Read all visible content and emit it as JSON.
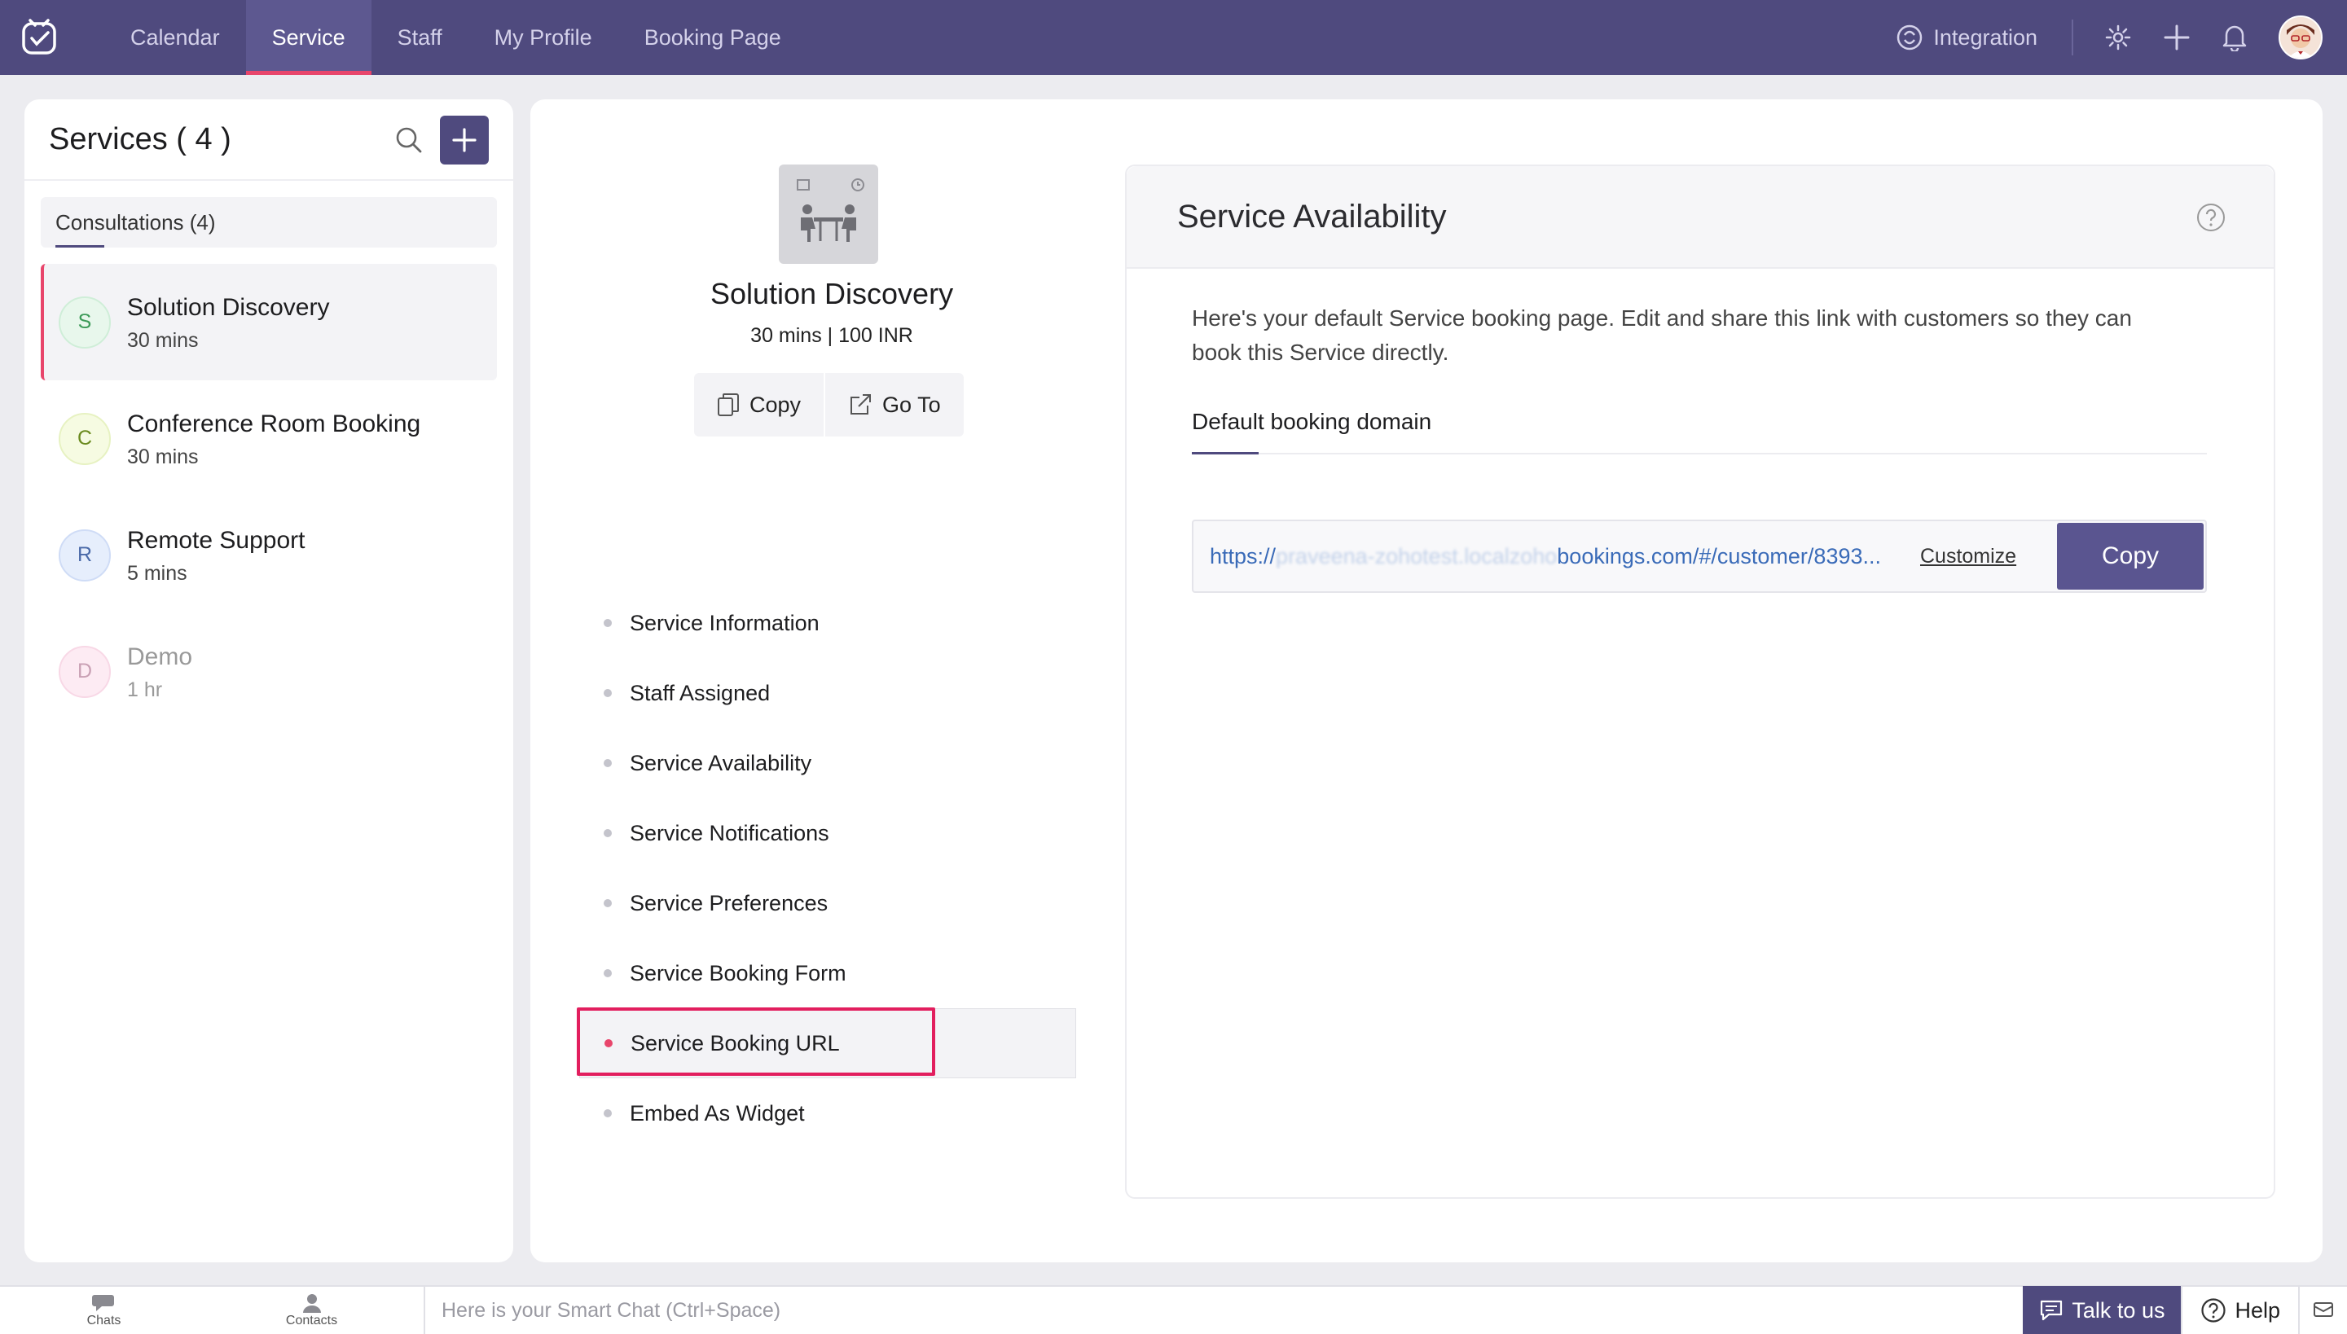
{
  "nav": {
    "items": [
      {
        "label": "Calendar",
        "active": false
      },
      {
        "label": "Service",
        "active": true
      },
      {
        "label": "Staff",
        "active": false
      },
      {
        "label": "My Profile",
        "active": false
      },
      {
        "label": "Booking Page",
        "active": false
      }
    ],
    "integration": "Integration"
  },
  "sidebar": {
    "title": "Services ( 4 )",
    "category": "Consultations (4)",
    "services": [
      {
        "initial": "S",
        "name": "Solution Discovery",
        "duration": "30 mins",
        "selected": true,
        "avatar_bg": "#e8f7ec",
        "avatar_fg": "#3c9a58"
      },
      {
        "initial": "C",
        "name": "Conference Room Booking",
        "duration": "30 mins",
        "selected": false,
        "avatar_bg": "#f6fbe2",
        "avatar_fg": "#6a8a1e"
      },
      {
        "initial": "R",
        "name": "Remote Support",
        "duration": "5 mins",
        "selected": false,
        "avatar_bg": "#e6eefc",
        "avatar_fg": "#4a6aa8"
      },
      {
        "initial": "D",
        "name": "Demo",
        "duration": "1 hr",
        "selected": false,
        "avatar_bg": "#fdebf3",
        "avatar_fg": "#c9a0b4"
      }
    ]
  },
  "detail": {
    "title": "Solution Discovery",
    "meta": "30 mins | 100 INR",
    "copy_label": "Copy",
    "goto_label": "Go To",
    "menu": [
      "Service Information",
      "Staff Assigned",
      "Service Availability",
      "Service Notifications",
      "Service Preferences",
      "Service Booking Form",
      "Service Booking URL",
      "Embed As Widget"
    ],
    "active_menu_index": 6
  },
  "availability": {
    "title": "Service Availability",
    "description": "Here's your default Service booking page. Edit and share this link with customers so they can book this Service directly.",
    "tab": "Default booking domain",
    "url_prefix": "https://",
    "url_blurred": "praveena-zohotest.localzoho",
    "url_suffix": "bookings.com/#/customer/8393...",
    "customize": "Customize",
    "copy": "Copy"
  },
  "bottombar": {
    "chats": "Chats",
    "contacts": "Contacts",
    "smart_chat_placeholder": "Here is your Smart Chat (Ctrl+Space)",
    "talk": "Talk to us",
    "help": "Help"
  },
  "colors": {
    "brand": "#4f4a7e",
    "accent": "#e8456b",
    "highlight_box": "#e21e5e",
    "link": "#3a6bb8"
  }
}
